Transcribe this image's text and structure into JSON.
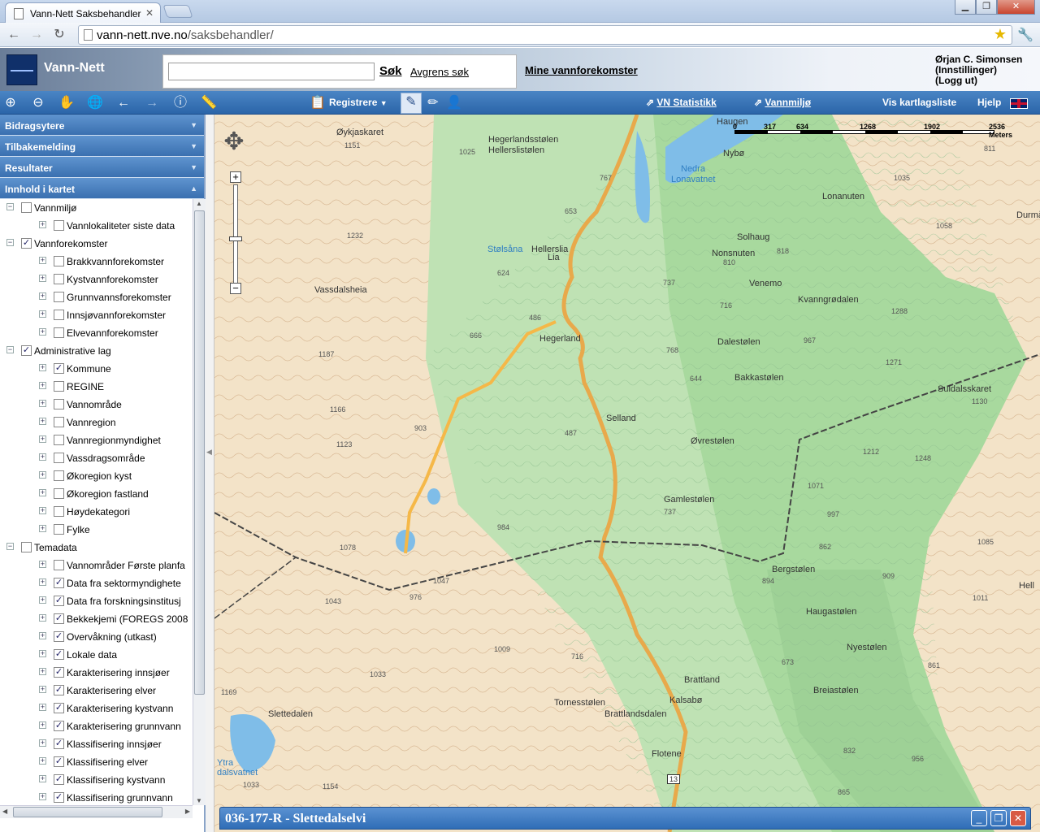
{
  "browser": {
    "tab_title": "Vann-Nett Saksbehandler",
    "url_host": "vann-nett.nve.no",
    "url_path": "/saksbehandler/"
  },
  "header": {
    "app_title": "Vann-Nett",
    "search_button": "Søk",
    "refine_link": "Avgrens søk",
    "mine_link": "Mine vannforekomster",
    "user_name": "Ørjan C. Simonsen",
    "settings_link": "(Innstillinger)",
    "logout_link": "(Logg ut)"
  },
  "toolbar": {
    "registrere": "Registrere",
    "vn_statistikk": "VN Statistikk",
    "vannmiljo": "Vannmiljø",
    "kartlagsliste": "Vis kartlagsliste",
    "hjelp": "Hjelp"
  },
  "sidebar": {
    "sections": [
      "Bidragsytere",
      "Tilbakemelding",
      "Resultater",
      "Innhold i kartet"
    ],
    "tree": [
      {
        "label": "Vannmiljø",
        "level": 0,
        "checked": false
      },
      {
        "label": "Vannlokaliteter siste data",
        "level": 1,
        "checked": false
      },
      {
        "label": "Vannforekomster",
        "level": 0,
        "checked": true
      },
      {
        "label": "Brakkvannforekomster",
        "level": 1,
        "checked": false
      },
      {
        "label": "Kystvannforekomster",
        "level": 1,
        "checked": false
      },
      {
        "label": "Grunnvannsforekomster",
        "level": 1,
        "checked": false
      },
      {
        "label": "Innsjøvannforekomster",
        "level": 1,
        "checked": false
      },
      {
        "label": "Elvevannforekomster",
        "level": 1,
        "checked": false
      },
      {
        "label": "Administrative lag",
        "level": 0,
        "checked": true
      },
      {
        "label": "Kommune",
        "level": 1,
        "checked": true
      },
      {
        "label": "REGINE",
        "level": 1,
        "checked": false
      },
      {
        "label": "Vannområde",
        "level": 1,
        "checked": false
      },
      {
        "label": "Vannregion",
        "level": 1,
        "checked": false
      },
      {
        "label": "Vannregionmyndighet",
        "level": 1,
        "checked": false
      },
      {
        "label": "Vassdragsområde",
        "level": 1,
        "checked": false
      },
      {
        "label": "Økoregion kyst",
        "level": 1,
        "checked": false
      },
      {
        "label": "Økoregion fastland",
        "level": 1,
        "checked": false
      },
      {
        "label": "Høydekategori",
        "level": 1,
        "checked": false
      },
      {
        "label": "Fylke",
        "level": 1,
        "checked": false
      },
      {
        "label": "Temadata",
        "level": 0,
        "checked": false
      },
      {
        "label": "Vannområder Første planfa",
        "level": 1,
        "checked": false
      },
      {
        "label": "Data fra sektormyndighete",
        "level": 1,
        "checked": true
      },
      {
        "label": "Data fra forskningsinstitusj",
        "level": 1,
        "checked": true
      },
      {
        "label": "Bekkekjemi (FOREGS 2008",
        "level": 1,
        "checked": true
      },
      {
        "label": "Overvåkning (utkast)",
        "level": 1,
        "checked": true
      },
      {
        "label": "Lokale data",
        "level": 1,
        "checked": true
      },
      {
        "label": "Karakterisering innsjøer",
        "level": 1,
        "checked": true
      },
      {
        "label": "Karakterisering elver",
        "level": 1,
        "checked": true
      },
      {
        "label": "Karakterisering kystvann",
        "level": 1,
        "checked": true
      },
      {
        "label": "Karakterisering grunnvann",
        "level": 1,
        "checked": true
      },
      {
        "label": "Klassifisering innsjøer",
        "level": 1,
        "checked": true
      },
      {
        "label": "Klassifisering elver",
        "level": 1,
        "checked": true
      },
      {
        "label": "Klassifisering kystvann",
        "level": 1,
        "checked": true
      },
      {
        "label": "Klassifisering grunnvann",
        "level": 1,
        "checked": true
      }
    ]
  },
  "map": {
    "scale_labels": [
      "0",
      "317",
      "634",
      "1268",
      "1902",
      "2536 Meters"
    ],
    "labels": [
      {
        "text": "Haugen",
        "kind": "place"
      },
      {
        "text": "Øykjaskaret",
        "kind": "place"
      },
      {
        "text": "Hegerlandsstølen",
        "kind": "place"
      },
      {
        "text": "Hellerslistølen",
        "kind": "place"
      },
      {
        "text": "Nybø",
        "kind": "place"
      },
      {
        "text": "Nedra",
        "kind": "water"
      },
      {
        "text": "Lonavatnet",
        "kind": "water"
      },
      {
        "text": "Lonanuten",
        "kind": "place"
      },
      {
        "text": "Durmåls",
        "kind": "place"
      },
      {
        "text": "Stølsåna",
        "kind": "water"
      },
      {
        "text": "Hellerslia",
        "kind": "place"
      },
      {
        "text": "Lia",
        "kind": "place"
      },
      {
        "text": "Solhaug",
        "kind": "place"
      },
      {
        "text": "Nonsnuten",
        "kind": "place"
      },
      {
        "text": "Vassdalsheia",
        "kind": "place"
      },
      {
        "text": "Venemo",
        "kind": "place"
      },
      {
        "text": "Kvanngrødalen",
        "kind": "place"
      },
      {
        "text": "Hegerland",
        "kind": "place"
      },
      {
        "text": "Dalestølen",
        "kind": "place"
      },
      {
        "text": "Bakkastølen",
        "kind": "place"
      },
      {
        "text": "Suldalsskaret",
        "kind": "place"
      },
      {
        "text": "Selland",
        "kind": "place"
      },
      {
        "text": "Øvrestølen",
        "kind": "place"
      },
      {
        "text": "Gamlestølen",
        "kind": "place"
      },
      {
        "text": "Bergstølen",
        "kind": "place"
      },
      {
        "text": "Haugastølen",
        "kind": "place"
      },
      {
        "text": "Nyestølen",
        "kind": "place"
      },
      {
        "text": "Brattland",
        "kind": "place"
      },
      {
        "text": "Kalsabø",
        "kind": "place"
      },
      {
        "text": "Tornesstølen",
        "kind": "place"
      },
      {
        "text": "Brattlandsdalen",
        "kind": "place"
      },
      {
        "text": "Breiastølen",
        "kind": "place"
      },
      {
        "text": "Slettedalen",
        "kind": "place"
      },
      {
        "text": "Flotene",
        "kind": "place"
      },
      {
        "text": "Ytra",
        "kind": "water"
      },
      {
        "text": "dalsvatnet",
        "kind": "water"
      },
      {
        "text": "Hell",
        "kind": "place"
      },
      {
        "text": "13",
        "kind": "road"
      }
    ],
    "heights": [
      "1151",
      "1025",
      "767",
      "653",
      "1035",
      "811",
      "1058",
      "1232",
      "624",
      "818",
      "737",
      "810",
      "716",
      "1288",
      "486",
      "666",
      "768",
      "967",
      "1271",
      "1187",
      "644",
      "1166",
      "1130",
      "903",
      "487",
      "1248",
      "1123",
      "1212",
      "1071",
      "997",
      "1078",
      "984",
      "737",
      "862",
      "1085",
      "1047",
      "976",
      "894",
      "909",
      "1043",
      "1011",
      "1009",
      "716",
      "1033",
      "673",
      "861",
      "1169",
      "832",
      "956",
      "1033",
      "1154",
      "865"
    ]
  },
  "infowindow": {
    "title": "036-177-R - Slettedalselvi"
  }
}
